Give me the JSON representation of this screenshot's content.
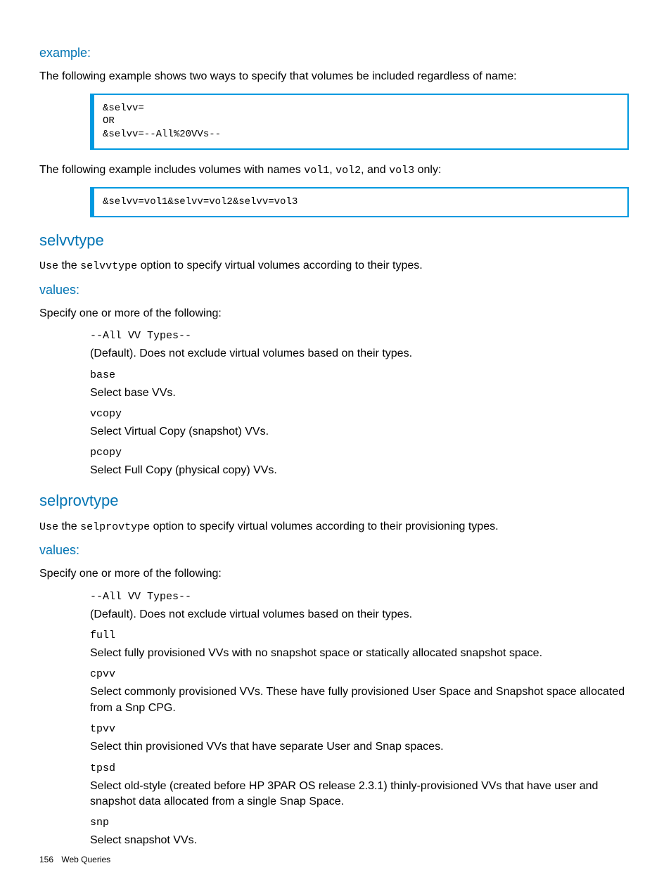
{
  "example": {
    "heading": "example:",
    "intro": "The following example shows two ways to specify that volumes be included regardless of name:",
    "code1": "&selvv=\nOR\n&selvv=--All%20VVs--",
    "mid_pre": "The following example includes volumes with names ",
    "mid_c1": "vol1",
    "mid_sep1": ", ",
    "mid_c2": "vol2",
    "mid_sep2": ", and ",
    "mid_c3": "vol3",
    "mid_post": " only:",
    "code2": "&selvv=vol1&selvv=vol2&selvv=vol3"
  },
  "selvvtype": {
    "heading": "selvvtype",
    "use_pre": "Use",
    "use_mid": " the ",
    "use_code": "selvvtype",
    "use_post": " option to specify virtual volumes according to their types.",
    "values_heading": "values:",
    "values_intro": "Specify one or more of the following:",
    "items": [
      {
        "code": "--All VV Types--",
        "desc": "(Default). Does not exclude virtual volumes based on their types."
      },
      {
        "code": "base",
        "desc": "Select base VVs."
      },
      {
        "code": "vcopy",
        "desc": "Select Virtual Copy (snapshot) VVs."
      },
      {
        "code": "pcopy",
        "desc": "Select Full Copy (physical copy) VVs."
      }
    ]
  },
  "selprovtype": {
    "heading": "selprovtype",
    "use_pre": "Use",
    "use_mid": " the ",
    "use_code": "selprovtype",
    "use_post": " option to specify virtual volumes according to their provisioning types.",
    "values_heading": "values:",
    "values_intro": "Specify one or more of the following:",
    "items": [
      {
        "code": "--All VV Types--",
        "desc": "(Default). Does not exclude virtual volumes based on their types."
      },
      {
        "code": "full",
        "desc": "Select fully provisioned VVs with no snapshot space or statically allocated snapshot space."
      },
      {
        "code": "cpvv",
        "desc": "Select commonly provisioned VVs. These have fully provisioned User Space and Snapshot space allocated from a Snp CPG."
      },
      {
        "code": "tpvv",
        "desc": "Select thin provisioned VVs that have separate User and Snap spaces."
      },
      {
        "code": "tpsd",
        "desc": "Select old-style (created before HP 3PAR OS release 2.3.1) thinly-provisioned VVs that have user and snapshot data allocated from a single Snap Space."
      },
      {
        "code": "snp",
        "desc": "Select snapshot VVs."
      }
    ]
  },
  "footer": {
    "page": "156",
    "title": "Web Queries"
  }
}
